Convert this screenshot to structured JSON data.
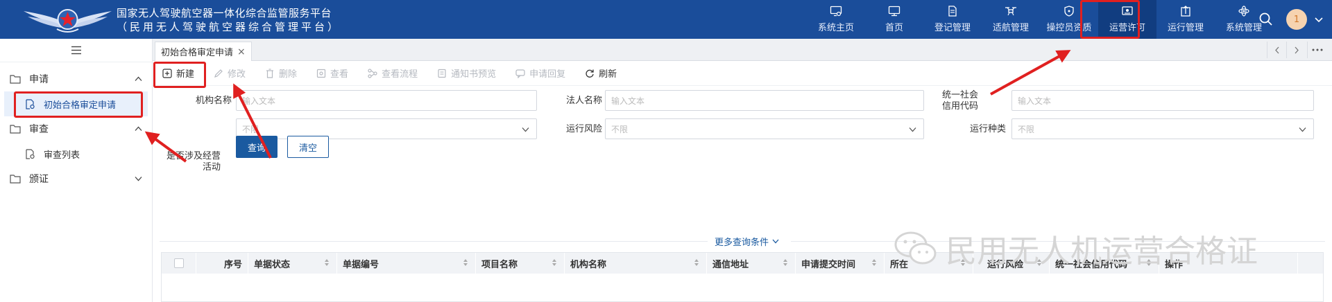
{
  "header": {
    "title_line1": "国家无人驾驶航空器一体化综合监管服务平台",
    "title_line2": "（民用无人驾驶航空器综合管理平台）",
    "nav": [
      {
        "label": "系统主页",
        "icon": "screen-gear-icon"
      },
      {
        "label": "首页",
        "icon": "monitor-icon"
      },
      {
        "label": "登记管理",
        "icon": "document-icon"
      },
      {
        "label": "适航管理",
        "icon": "drone-icon"
      },
      {
        "label": "操控员资质",
        "icon": "shield-icon"
      },
      {
        "label": "运营许可",
        "icon": "certificate-icon",
        "active": true
      },
      {
        "label": "运行管理",
        "icon": "upload-doc-icon"
      },
      {
        "label": "系统管理",
        "icon": "atom-icon"
      }
    ],
    "avatar_text": "1",
    "accent_color": "#1a4d9a"
  },
  "sidebar": {
    "group1": {
      "label": "申请"
    },
    "group1_item": {
      "label": "初始合格审定申请"
    },
    "group2": {
      "label": "审查"
    },
    "group2_item": {
      "label": "审查列表"
    },
    "group3": {
      "label": "颁证"
    }
  },
  "tabs": {
    "active": {
      "label": "初始合格审定申请",
      "close": "×"
    }
  },
  "toolbar": {
    "new": "新建",
    "edit": "修改",
    "delete": "删除",
    "view": "查看",
    "view_flow": "查看流程",
    "notice_preview": "通知书预览",
    "reply": "申请回复",
    "refresh": "刷新"
  },
  "form": {
    "org_name_label": "机构名称",
    "org_name_placeholder": "输入文本",
    "legal_rep_label": "法人名称",
    "legal_rep_placeholder": "输入文本",
    "credit_code_label": "统一社会信用代码",
    "credit_code_placeholder": "输入文本",
    "business_label": "是否涉及经营活动",
    "business_value": "不限",
    "risk_label": "运行风险",
    "risk_value": "不限",
    "type_label": "运行种类",
    "type_value": "不限",
    "query": "查询",
    "clear": "清空",
    "more": "更多查询条件"
  },
  "table": {
    "columns": [
      "序号",
      "单据状态",
      "单据编号",
      "项目名称",
      "机构名称",
      "通信地址",
      "申请提交时间",
      "所在",
      "运行风险",
      "统一社会信用代码",
      "操作"
    ]
  },
  "watermark": {
    "text": "民用无人机运营合格证"
  }
}
